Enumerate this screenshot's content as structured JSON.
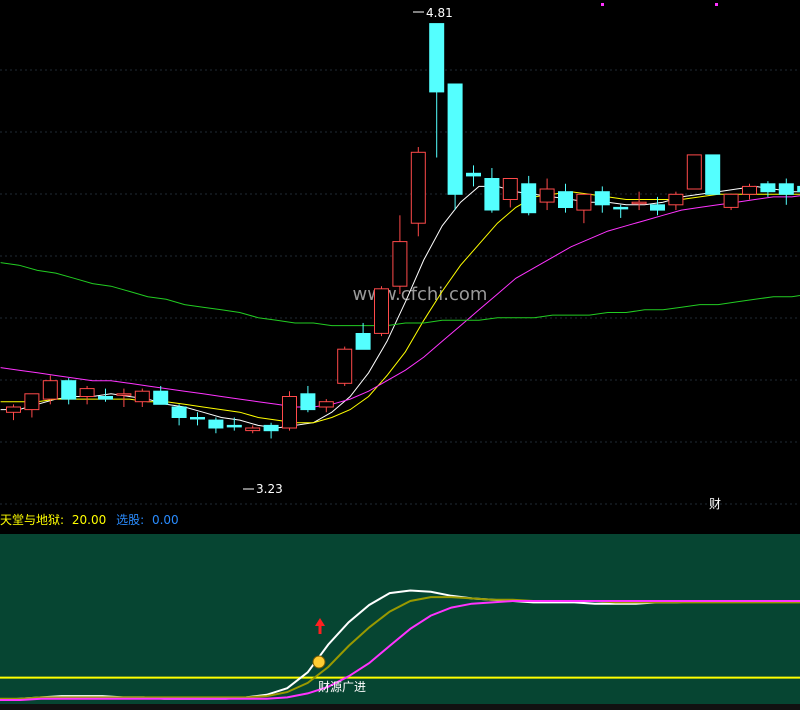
{
  "chart_data": [
    {
      "type": "candlestick",
      "title": "",
      "price_ylim": [
        2.95,
        4.9
      ],
      "high_label": "4.81",
      "low_label": "3.23",
      "marker_label": "财",
      "watermark": "www.cfchi.com",
      "candles": [
        {
          "o": 3.33,
          "h": 3.36,
          "l": 3.3,
          "c": 3.35,
          "up": true
        },
        {
          "o": 3.34,
          "h": 3.4,
          "l": 3.31,
          "c": 3.4,
          "up": true
        },
        {
          "o": 3.38,
          "h": 3.47,
          "l": 3.36,
          "c": 3.45,
          "up": true
        },
        {
          "o": 3.45,
          "h": 3.46,
          "l": 3.36,
          "c": 3.38,
          "up": false
        },
        {
          "o": 3.39,
          "h": 3.43,
          "l": 3.36,
          "c": 3.42,
          "up": true
        },
        {
          "o": 3.39,
          "h": 3.42,
          "l": 3.37,
          "c": 3.38,
          "up": false
        },
        {
          "o": 3.4,
          "h": 3.42,
          "l": 3.35,
          "c": 3.4,
          "up": true
        },
        {
          "o": 3.41,
          "h": 3.42,
          "l": 3.35,
          "c": 3.37,
          "up": true
        },
        {
          "o": 3.41,
          "h": 3.43,
          "l": 3.36,
          "c": 3.36,
          "up": false
        },
        {
          "o": 3.35,
          "h": 3.36,
          "l": 3.28,
          "c": 3.31,
          "up": false
        },
        {
          "o": 3.31,
          "h": 3.33,
          "l": 3.28,
          "c": 3.31,
          "up": false
        },
        {
          "o": 3.3,
          "h": 3.31,
          "l": 3.25,
          "c": 3.27,
          "up": false
        },
        {
          "o": 3.28,
          "h": 3.31,
          "l": 3.26,
          "c": 3.28,
          "up": false
        },
        {
          "o": 3.26,
          "h": 3.28,
          "l": 3.25,
          "c": 3.27,
          "up": true
        },
        {
          "o": 3.28,
          "h": 3.29,
          "l": 3.23,
          "c": 3.26,
          "up": false
        },
        {
          "o": 3.27,
          "h": 3.41,
          "l": 3.26,
          "c": 3.39,
          "up": true
        },
        {
          "o": 3.4,
          "h": 3.43,
          "l": 3.33,
          "c": 3.34,
          "up": false
        },
        {
          "o": 3.35,
          "h": 3.38,
          "l": 3.33,
          "c": 3.37,
          "up": true
        },
        {
          "o": 3.44,
          "h": 3.58,
          "l": 3.43,
          "c": 3.57,
          "up": true
        },
        {
          "o": 3.57,
          "h": 3.67,
          "l": 3.57,
          "c": 3.63,
          "up": false
        },
        {
          "o": 3.63,
          "h": 3.81,
          "l": 3.62,
          "c": 3.8,
          "up": true
        },
        {
          "o": 3.81,
          "h": 4.08,
          "l": 3.78,
          "c": 3.98,
          "up": true
        },
        {
          "o": 4.05,
          "h": 4.34,
          "l": 4.0,
          "c": 4.32,
          "up": true
        },
        {
          "o": 4.55,
          "h": 4.81,
          "l": 4.3,
          "c": 4.81,
          "up": false
        },
        {
          "o": 4.58,
          "h": 4.58,
          "l": 4.1,
          "c": 4.16,
          "up": false
        },
        {
          "o": 4.24,
          "h": 4.27,
          "l": 4.19,
          "c": 4.23,
          "up": false
        },
        {
          "o": 4.22,
          "h": 4.26,
          "l": 4.09,
          "c": 4.1,
          "up": false
        },
        {
          "o": 4.14,
          "h": 4.22,
          "l": 4.11,
          "c": 4.22,
          "up": true
        },
        {
          "o": 4.2,
          "h": 4.23,
          "l": 4.08,
          "c": 4.09,
          "up": false
        },
        {
          "o": 4.18,
          "h": 4.22,
          "l": 4.1,
          "c": 4.13,
          "up": true
        },
        {
          "o": 4.17,
          "h": 4.2,
          "l": 4.09,
          "c": 4.11,
          "up": false
        },
        {
          "o": 4.16,
          "h": 4.16,
          "l": 4.05,
          "c": 4.1,
          "up": true
        },
        {
          "o": 4.17,
          "h": 4.19,
          "l": 4.09,
          "c": 4.12,
          "up": false
        },
        {
          "o": 4.11,
          "h": 4.12,
          "l": 4.07,
          "c": 4.11,
          "up": false
        },
        {
          "o": 4.13,
          "h": 4.17,
          "l": 4.1,
          "c": 4.13,
          "up": true
        },
        {
          "o": 4.12,
          "h": 4.15,
          "l": 4.08,
          "c": 4.1,
          "up": false
        },
        {
          "o": 4.12,
          "h": 4.17,
          "l": 4.1,
          "c": 4.16,
          "up": true
        },
        {
          "o": 4.18,
          "h": 4.31,
          "l": 4.18,
          "c": 4.31,
          "up": true
        },
        {
          "o": 4.31,
          "h": 4.31,
          "l": 4.16,
          "c": 4.16,
          "up": false
        },
        {
          "o": 4.11,
          "h": 4.16,
          "l": 4.1,
          "c": 4.16,
          "up": true
        },
        {
          "o": 4.16,
          "h": 4.2,
          "l": 4.14,
          "c": 4.19,
          "up": true
        },
        {
          "o": 4.17,
          "h": 4.21,
          "l": 4.15,
          "c": 4.2,
          "up": false
        },
        {
          "o": 4.2,
          "h": 4.22,
          "l": 4.12,
          "c": 4.16,
          "up": false
        },
        {
          "o": 4.19,
          "h": 4.21,
          "l": 4.16,
          "c": 4.17,
          "up": false
        },
        {
          "o": 4.16,
          "h": 4.22,
          "l": 4.15,
          "c": 4.21,
          "up": true
        }
      ],
      "ma_lines": [
        {
          "color": "#ffffff",
          "values": [
            3.34,
            3.34,
            3.36,
            3.38,
            3.39,
            3.39,
            3.4,
            3.39,
            3.38,
            3.36,
            3.35,
            3.33,
            3.31,
            3.3,
            3.28,
            3.27,
            3.28,
            3.29,
            3.33,
            3.39,
            3.48,
            3.6,
            3.75,
            3.91,
            4.04,
            4.13,
            4.19,
            4.19,
            4.17,
            4.16,
            4.15,
            4.14,
            4.13,
            4.13,
            4.12,
            4.12,
            4.13,
            4.15,
            4.16,
            4.17,
            4.18,
            4.19,
            4.18,
            4.17,
            4.17
          ]
        },
        {
          "color": "#ffff00",
          "values": [
            3.37,
            3.37,
            3.37,
            3.38,
            3.38,
            3.38,
            3.38,
            3.38,
            3.37,
            3.37,
            3.36,
            3.35,
            3.34,
            3.33,
            3.31,
            3.3,
            3.29,
            3.29,
            3.31,
            3.34,
            3.39,
            3.47,
            3.56,
            3.68,
            3.79,
            3.89,
            3.97,
            4.05,
            4.11,
            4.15,
            4.16,
            4.17,
            4.16,
            4.15,
            4.14,
            4.14,
            4.14,
            4.14,
            4.15,
            4.16,
            4.16,
            4.16,
            4.16,
            4.16,
            4.16
          ]
        },
        {
          "color": "#ff33ff",
          "values": [
            3.5,
            3.49,
            3.48,
            3.47,
            3.46,
            3.45,
            3.45,
            3.44,
            3.43,
            3.42,
            3.41,
            3.4,
            3.39,
            3.38,
            3.37,
            3.36,
            3.35,
            3.35,
            3.36,
            3.38,
            3.41,
            3.45,
            3.49,
            3.54,
            3.6,
            3.66,
            3.72,
            3.78,
            3.84,
            3.88,
            3.92,
            3.96,
            3.99,
            4.02,
            4.04,
            4.06,
            4.08,
            4.1,
            4.11,
            4.12,
            4.13,
            4.14,
            4.15,
            4.15,
            4.16
          ]
        },
        {
          "color": "#22cc22",
          "values": [
            3.9,
            3.89,
            3.87,
            3.86,
            3.84,
            3.82,
            3.81,
            3.79,
            3.77,
            3.76,
            3.74,
            3.73,
            3.72,
            3.71,
            3.69,
            3.68,
            3.67,
            3.67,
            3.66,
            3.66,
            3.66,
            3.66,
            3.67,
            3.67,
            3.68,
            3.68,
            3.68,
            3.69,
            3.69,
            3.69,
            3.7,
            3.7,
            3.7,
            3.71,
            3.71,
            3.72,
            3.72,
            3.73,
            3.74,
            3.74,
            3.75,
            3.76,
            3.77,
            3.77,
            3.78
          ]
        }
      ]
    },
    {
      "type": "line",
      "indicator_name": "天堂与地狱:",
      "indicator_value": "20.00",
      "pick_label": "选股:",
      "pick_value": "0.00",
      "signal_label": "财源广进",
      "threshold": 20,
      "ylim": [
        0,
        100
      ],
      "series": [
        {
          "color": "#ffffff",
          "values": [
            3,
            4,
            5,
            6,
            6,
            6,
            5,
            5,
            4,
            4,
            4,
            4,
            5,
            7,
            12,
            24,
            45,
            62,
            75,
            84,
            86,
            85,
            82,
            80,
            79,
            78,
            77,
            77,
            77,
            76,
            76,
            76,
            77,
            77,
            78,
            78,
            78,
            78,
            78,
            78
          ]
        },
        {
          "color": "#999900",
          "values": [
            4,
            4,
            5,
            5,
            5,
            5,
            5,
            5,
            5,
            5,
            5,
            5,
            5,
            6,
            9,
            16,
            28,
            44,
            58,
            70,
            78,
            81,
            81,
            80,
            79,
            79,
            78,
            78,
            78,
            78,
            77,
            77,
            77,
            77,
            77,
            77,
            77,
            77,
            77,
            77
          ]
        },
        {
          "color": "#ff33ff",
          "values": [
            3,
            3,
            4,
            4,
            4,
            4,
            4,
            4,
            4,
            4,
            4,
            4,
            4,
            4,
            5,
            8,
            13,
            21,
            31,
            44,
            57,
            67,
            73,
            76,
            77,
            78,
            78,
            78,
            78,
            78,
            78,
            78,
            78,
            78,
            78,
            78,
            78,
            78,
            78,
            78
          ]
        }
      ]
    }
  ]
}
